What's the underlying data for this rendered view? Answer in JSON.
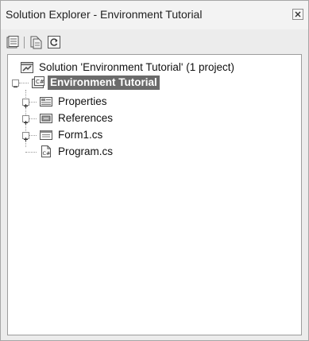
{
  "window": {
    "title": "Solution Explorer - Environment Tutorial"
  },
  "toolbar": {
    "buttons": [
      {
        "name": "properties-icon"
      },
      {
        "name": "show-all-files-icon"
      },
      {
        "name": "refresh-icon"
      }
    ]
  },
  "tree": {
    "solution": {
      "label": "Solution 'Environment Tutorial' (1 project)",
      "icon": "solution-icon"
    },
    "project": {
      "label": "Environment Tutorial",
      "icon": "csharp-project-icon",
      "selected": true
    },
    "children": [
      {
        "label": "Properties",
        "icon": "properties-folder-icon",
        "expandable": true
      },
      {
        "label": "References",
        "icon": "references-folder-icon",
        "expandable": true
      },
      {
        "label": "Form1.cs",
        "icon": "form-icon",
        "expandable": true
      },
      {
        "label": "Program.cs",
        "icon": "csharp-file-icon",
        "expandable": false
      }
    ]
  },
  "colors": {
    "selection": "#6b6b6b",
    "panel_background": "#ffffff",
    "chrome_background": "#ececec"
  }
}
